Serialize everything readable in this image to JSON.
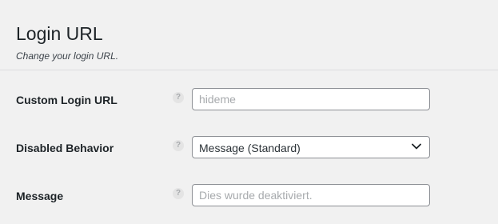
{
  "header": {
    "title": "Login URL",
    "subtitle": "Change your login URL."
  },
  "fields": {
    "custom_login_url": {
      "label": "Custom Login URL",
      "help": "?",
      "value": "",
      "placeholder": "hideme"
    },
    "disabled_behavior": {
      "label": "Disabled Behavior",
      "help": "?",
      "selected": "Message (Standard)",
      "icon": "chevron-down-icon"
    },
    "message": {
      "label": "Message",
      "help": "?",
      "value": "",
      "placeholder": "Dies wurde deaktiviert."
    }
  },
  "colors": {
    "background": "#f1f1f1",
    "text": "#1d2327",
    "border": "#8c8f94",
    "placeholder": "#a7aaad",
    "divider": "#dcdcde"
  }
}
